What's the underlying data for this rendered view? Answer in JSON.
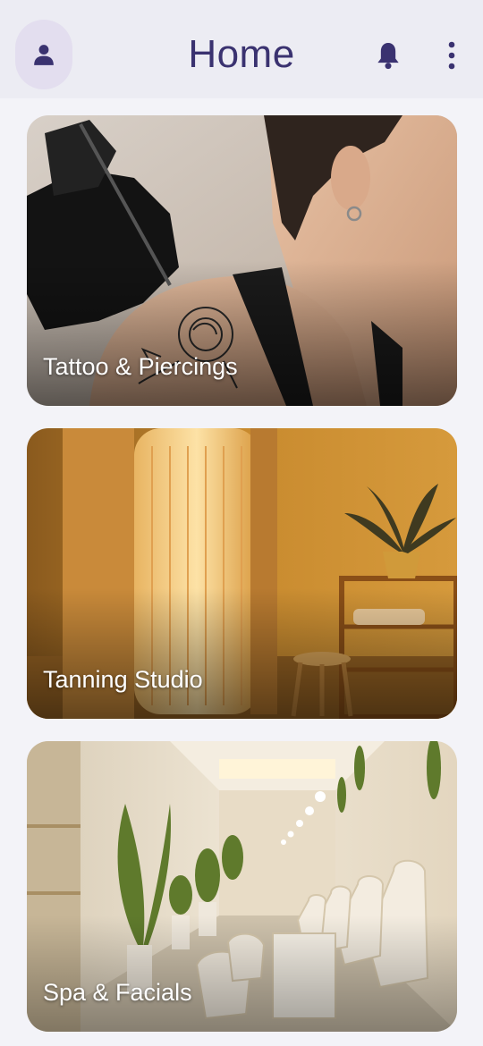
{
  "header": {
    "title": "Home",
    "icons": {
      "profile": "person-icon",
      "notifications": "bell-icon",
      "more": "more-vertical-icon"
    },
    "accent_color": "#3a3270",
    "avatar_bg": "#e3deef"
  },
  "categories": [
    {
      "label": "Tattoo & Piercings",
      "image": "tattoo-artist-inking-rose-on-shoulder"
    },
    {
      "label": "Tanning Studio",
      "image": "tanning-booth-room-amber"
    },
    {
      "label": "Spa & Facials",
      "image": "spa-salon-interior-with-chairs"
    }
  ]
}
